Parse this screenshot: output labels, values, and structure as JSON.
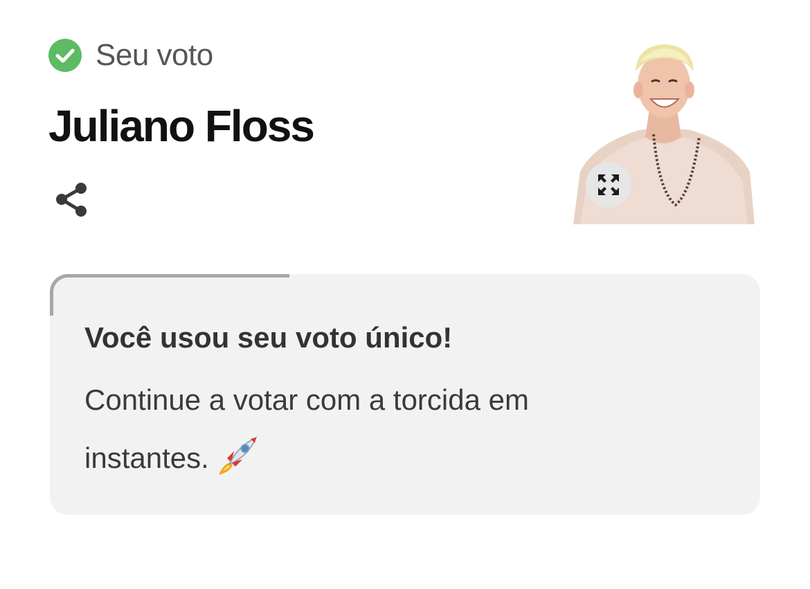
{
  "vote": {
    "status_label": "Seu voto",
    "participant_name": "Juliano Floss"
  },
  "icons": {
    "status": "check-circle-icon",
    "share": "share-icon",
    "expand": "expand-icon",
    "rocket": "rocket-emoji-icon"
  },
  "notice": {
    "title": "Você usou seu voto único!",
    "message": "Continue a votar com a torcida em instantes."
  },
  "colors": {
    "check": "#5dbb63",
    "card_background": "#f2f2f2",
    "progress": "#a7a7a7"
  }
}
